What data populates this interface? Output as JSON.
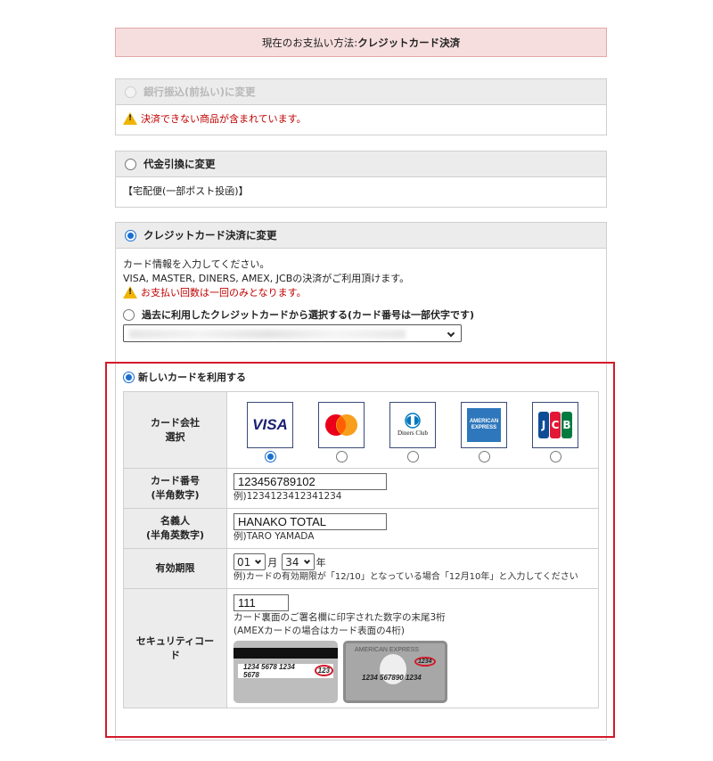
{
  "notice": {
    "prefix": "現在のお支払い方法:",
    "method": "クレジットカード決済"
  },
  "bank": {
    "title": "銀行振込(前払い)に変更",
    "warning": "決済できない商品が含まれています。"
  },
  "cod": {
    "title": "代金引換に変更",
    "note": "【宅配便(一部ポスト投函)】"
  },
  "credit": {
    "title": "クレジットカード決済に変更",
    "intro_line1": "カード情報を入力してください。",
    "intro_line2": "VISA, MASTER, DINERS, AMEX, JCBの決済がご利用頂けます。",
    "warning": "お支払い回数は一回のみとなります。",
    "past_card_label": "過去に利用したクレジットカードから選択する(カード番号は一部伏字です)",
    "new_card_label": "新しいカードを利用する",
    "brand_label_line1": "カード会社",
    "brand_label_line2": "選択",
    "brands": [
      {
        "name": "VISA",
        "selected": true
      },
      {
        "name": "Mastercard",
        "selected": false
      },
      {
        "name": "Diners Club",
        "selected": false
      },
      {
        "name": "AMERICAN EXPRESS",
        "selected": false
      },
      {
        "name": "JCB",
        "selected": false
      }
    ],
    "card_number_label_line1": "カード番号",
    "card_number_label_line2": "(半角数字)",
    "card_number_value": "123456789102",
    "card_number_example": "例)1234123412341234",
    "holder_label_line1": "名義人",
    "holder_label_line2": "(半角英数字)",
    "holder_value": "HANAKO TOTAL",
    "holder_example": "例)TARO YAMADA",
    "expiry_label": "有効期限",
    "expiry_month": "01",
    "expiry_month_unit": "月",
    "expiry_year": "34",
    "expiry_year_unit": "年",
    "expiry_example": "例)カードの有効期限が「12/10」となっている場合「12月10年」と入力してください",
    "cvc_label_line1": "セキュリティコー",
    "cvc_label_line2": "ド",
    "cvc_value": "111",
    "cvc_hint1": "カード裏面のご署名欄に印字された数字の末尾3桁",
    "cvc_hint2": "(AMEXカードの場合はカード表面の4桁)",
    "back_card_number": "1234 5678 1234 5678",
    "back_card_code": "123",
    "amex_card_brand": "AMERICAN EXPRESS",
    "amex_card_code": "1234",
    "amex_card_number": "1234 567890 1234"
  },
  "colors": {
    "accent": "#1a6fd1",
    "warning_red": "#c00000",
    "highlight": "#d21a2a"
  }
}
